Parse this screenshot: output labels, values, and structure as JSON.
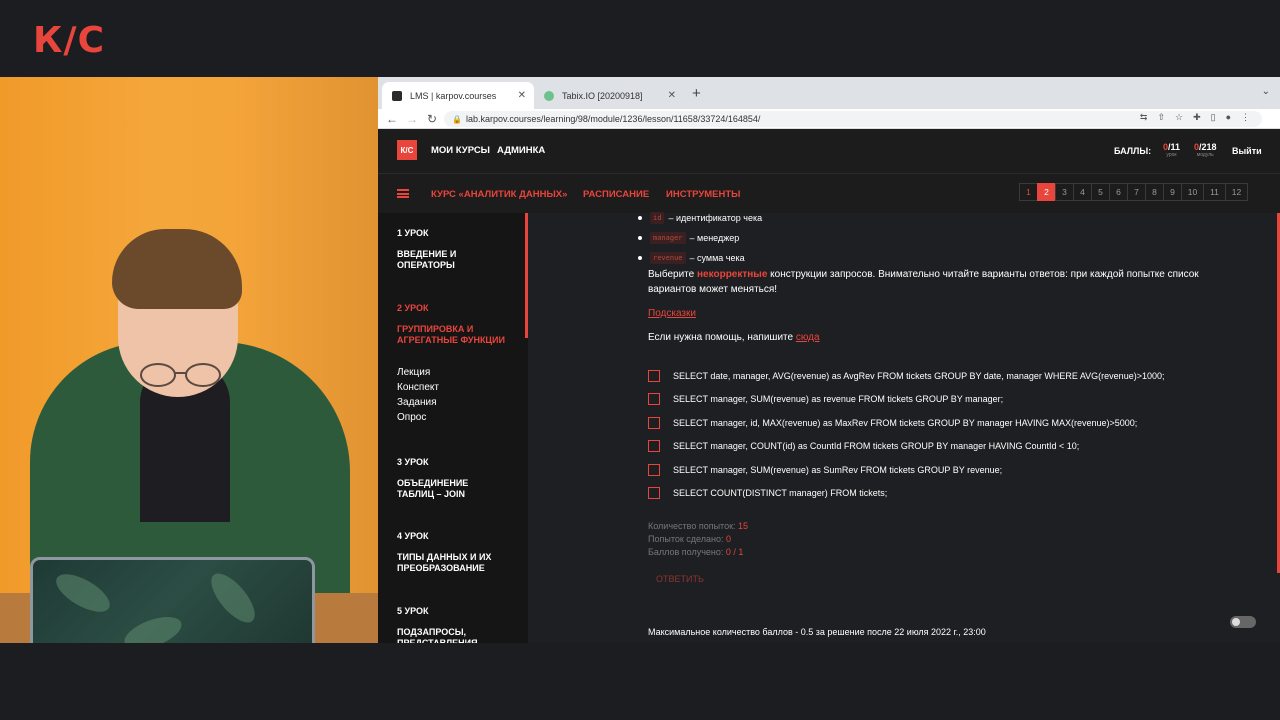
{
  "brand": {
    "logo_text": "К/С"
  },
  "browser": {
    "tabs": [
      {
        "label": "LMS | karpov.courses",
        "active": true
      },
      {
        "label": "Tabix.IO [20200918]",
        "active": false
      }
    ],
    "url": "lab.karpov.courses/learning/98/module/1236/lesson/11658/33724/164854/"
  },
  "site": {
    "logo": "К/С",
    "nav": {
      "my_courses": "МОИ КУРСЫ",
      "admin": "АДМИНКА"
    },
    "score_label": "БАЛЛЫ:",
    "scores": [
      {
        "value": "0",
        "total": "/11",
        "caption": "урок"
      },
      {
        "value": "0",
        "total": "/218",
        "caption": "модуль"
      }
    ],
    "logout": "Выйти",
    "subnav": {
      "course": "КУРС «АНАЛИТИК ДАННЫХ»",
      "schedule": "РАСПИСАНИЕ",
      "tools": "ИНСТРУМЕНТЫ"
    },
    "pages": [
      "1",
      "2",
      "3",
      "4",
      "5",
      "6",
      "7",
      "8",
      "9",
      "10",
      "11",
      "12"
    ],
    "active_page": "2"
  },
  "sidebar": {
    "lessons": [
      {
        "num": "1 УРОК",
        "title": "ВВЕДЕНИЕ И ОПЕРАТОРЫ"
      },
      {
        "num": "2 УРОК",
        "title": "ГРУППИРОВКА И АГРЕГАТНЫЕ ФУНКЦИИ"
      },
      {
        "num": "3 УРОК",
        "title": "ОБЪЕДИНЕНИЕ ТАБЛИЦ – JOIN"
      },
      {
        "num": "4 УРОК",
        "title": "ТИПЫ ДАННЫХ И ИХ ПРЕОБРАЗОВАНИЕ"
      },
      {
        "num": "5 УРОК",
        "title": "ПОДЗАПРОСЫ, ПРЕДСТАВЛЕНИЯ"
      }
    ],
    "lesson2_items": [
      "Лекция",
      "Конспект",
      "Задания",
      "Опрос"
    ]
  },
  "main": {
    "bullets": [
      {
        "code": "id",
        "text": "– идентификатор чека"
      },
      {
        "code": "manager",
        "text": "– менеджер"
      },
      {
        "code": "revenue",
        "text": "– сумма чека"
      }
    ],
    "instruction_pre": "Выберите ",
    "instruction_highlight": "некорректные",
    "instruction_post": " конструкции запросов. Внимательно читайте варианты ответов: при каждой попытке список вариантов может меняться!",
    "hints_link": "Подсказки",
    "help_text": "Если нужна помощь, напишите ",
    "help_link": "сюда",
    "options": [
      "SELECT date, manager, AVG(revenue) as AvgRev FROM tickets GROUP BY date, manager WHERE AVG(revenue)>1000;",
      "SELECT manager, SUM(revenue) as revenue FROM tickets GROUP BY manager;",
      "SELECT manager, id, MAX(revenue) as MaxRev FROM tickets GROUP BY manager HAVING MAX(revenue)>5000;",
      "SELECT manager, COUNT(id) as CountId FROM tickets GROUP BY manager HAVING CountId < 10;",
      "SELECT manager, SUM(revenue) as SumRev FROM tickets GROUP BY revenue;",
      "SELECT COUNT(DISTINCT manager) FROM tickets;"
    ],
    "stats": [
      {
        "label": "Количество попыток: ",
        "value": "15"
      },
      {
        "label": "Попыток сделано: ",
        "value": "0"
      },
      {
        "label": "Баллов получено: ",
        "value": "0 / 1"
      }
    ],
    "answer_button": "ОТВЕТИТЬ",
    "footer_note": "Максимальное количество баллов - 0.5 за решение после 22 июля 2022 г., 23:00"
  }
}
